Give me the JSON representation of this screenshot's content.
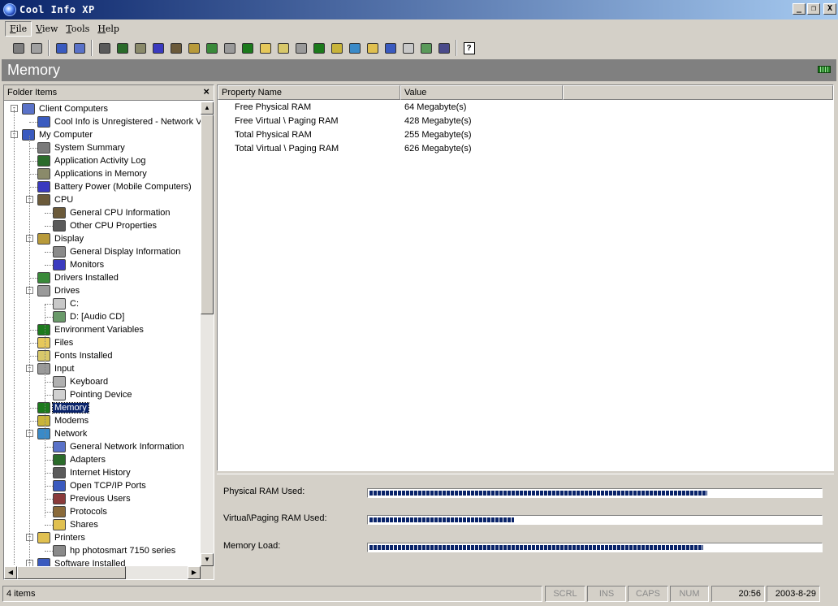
{
  "window": {
    "title": "Cool Info XP",
    "buttons": {
      "minimize": "_",
      "maximize": "❐",
      "close": "X"
    }
  },
  "menu": [
    {
      "label": "File",
      "accel": "F",
      "rest": "ile"
    },
    {
      "label": "View",
      "accel": "V",
      "rest": "iew"
    },
    {
      "label": "Tools",
      "accel": "T",
      "rest": "ools"
    },
    {
      "label": "Help",
      "accel": "H",
      "rest": "elp"
    }
  ],
  "toolbar": {
    "icons": [
      {
        "name": "cube-icon",
        "color": "#7f7f7f"
      },
      {
        "name": "network-client-icon",
        "color": "#a0a0a0"
      },
      "sep",
      {
        "name": "client-remote-icon",
        "color": "#3a5bbf"
      },
      {
        "name": "client-settings-icon",
        "color": "#5a72c8"
      },
      "sep",
      {
        "name": "computer-icon",
        "color": "#5a5a5a"
      },
      {
        "name": "activity-log-icon",
        "color": "#2a6b2a"
      },
      {
        "name": "applications-icon",
        "color": "#8a8a6a"
      },
      {
        "name": "battery-icon",
        "color": "#3a3abf"
      },
      {
        "name": "cpu-icon",
        "color": "#6b5a3a"
      },
      {
        "name": "display-icon",
        "color": "#b89a3a"
      },
      {
        "name": "drivers-icon",
        "color": "#3a8a3a"
      },
      {
        "name": "drives-icon",
        "color": "#9a9a9a"
      },
      {
        "name": "environment-icon",
        "color": "#1c7a1c"
      },
      {
        "name": "files-icon",
        "color": "#e6c85a"
      },
      {
        "name": "fonts-icon",
        "color": "#d8c86a"
      },
      {
        "name": "input-icon",
        "color": "#9a9a9a"
      },
      {
        "name": "memory-icon",
        "color": "#1c7a1c"
      },
      {
        "name": "modems-icon",
        "color": "#c8b43a"
      },
      {
        "name": "network-icon",
        "color": "#3a8ac8"
      },
      {
        "name": "printers-icon",
        "color": "#e0c050"
      },
      {
        "name": "software-icon",
        "color": "#3a5abf"
      },
      {
        "name": "sound-icon",
        "color": "#c8c8c8"
      },
      {
        "name": "system-icon",
        "color": "#5a9a5a"
      },
      {
        "name": "tools-icon",
        "color": "#4a4a8a"
      },
      "sep",
      {
        "name": "help-icon",
        "color": "#ffffff"
      }
    ]
  },
  "section": {
    "title": "Memory",
    "icon": "memory-icon"
  },
  "folder_panel": {
    "title": "Folder Items",
    "close": "×",
    "items": [
      {
        "label": "Client Computers",
        "level": 0,
        "expander": "-",
        "icon": "clients-icon",
        "color": "#5a72c8"
      },
      {
        "label": "Cool Info is Unregistered - Network Version",
        "level": 1,
        "icon": "client-icon",
        "color": "#3a5bbf"
      },
      {
        "label": "My Computer",
        "level": 0,
        "expander": "-",
        "icon": "my-computer-icon",
        "color": "#3a5abf"
      },
      {
        "label": "System Summary",
        "level": 1,
        "icon": "computer-icon",
        "color": "#7a7a7a"
      },
      {
        "label": "Application Activity Log",
        "level": 1,
        "icon": "activity-log-icon",
        "color": "#2a6b2a"
      },
      {
        "label": "Applications in Memory",
        "level": 1,
        "icon": "applications-icon",
        "color": "#8a8a6a"
      },
      {
        "label": "Battery Power (Mobile Computers)",
        "level": 1,
        "icon": "battery-icon",
        "color": "#3a3abf"
      },
      {
        "label": "CPU",
        "level": 1,
        "expander": "-",
        "icon": "cpu-icon",
        "color": "#6b5a3a"
      },
      {
        "label": "General CPU Information",
        "level": 2,
        "icon": "cpu-info-icon",
        "color": "#6b5a3a"
      },
      {
        "label": "Other CPU Properties",
        "level": 2,
        "icon": "cpu-props-icon",
        "color": "#5a5a5a"
      },
      {
        "label": "Display",
        "level": 1,
        "expander": "-",
        "icon": "display-icon",
        "color": "#b89a3a"
      },
      {
        "label": "General Display Information",
        "level": 2,
        "icon": "display-info-icon",
        "color": "#8a8a8a"
      },
      {
        "label": "Monitors",
        "level": 2,
        "icon": "monitor-icon",
        "color": "#3a3abf"
      },
      {
        "label": "Drivers Installed",
        "level": 1,
        "icon": "drivers-icon",
        "color": "#3a8a3a"
      },
      {
        "label": "Drives",
        "level": 1,
        "expander": "-",
        "icon": "drives-icon",
        "color": "#9a9a9a"
      },
      {
        "label": "C:",
        "level": 2,
        "icon": "hard-drive-icon",
        "color": "#c8c8c8"
      },
      {
        "label": "D: [Audio CD]",
        "level": 2,
        "icon": "cd-drive-icon",
        "color": "#6a9a6a"
      },
      {
        "label": "Environment Variables",
        "level": 1,
        "icon": "environment-icon",
        "color": "#1c7a1c"
      },
      {
        "label": "Files",
        "level": 1,
        "icon": "files-icon",
        "color": "#e6c85a"
      },
      {
        "label": "Fonts Installed",
        "level": 1,
        "icon": "fonts-icon",
        "color": "#d8c86a"
      },
      {
        "label": "Input",
        "level": 1,
        "expander": "-",
        "icon": "input-icon",
        "color": "#9a9a9a"
      },
      {
        "label": "Keyboard",
        "level": 2,
        "icon": "keyboard-icon",
        "color": "#b0b0b0"
      },
      {
        "label": "Pointing Device",
        "level": 2,
        "icon": "mouse-icon",
        "color": "#d0d0d0"
      },
      {
        "label": "Memory",
        "level": 1,
        "icon": "memory-icon",
        "color": "#1c7a1c",
        "selected": true
      },
      {
        "label": "Modems",
        "level": 1,
        "icon": "modems-icon",
        "color": "#c8b43a"
      },
      {
        "label": "Network",
        "level": 1,
        "expander": "-",
        "icon": "network-icon",
        "color": "#3a8ac8"
      },
      {
        "label": "General Network Information",
        "level": 2,
        "icon": "network-info-icon",
        "color": "#5a72c8"
      },
      {
        "label": "Adapters",
        "level": 2,
        "icon": "adapter-icon",
        "color": "#2a6b2a"
      },
      {
        "label": "Internet History",
        "level": 2,
        "icon": "history-icon",
        "color": "#5a5a5a"
      },
      {
        "label": "Open TCP/IP Ports",
        "level": 2,
        "icon": "ports-icon",
        "color": "#3a5abf"
      },
      {
        "label": "Previous Users",
        "level": 2,
        "icon": "users-icon",
        "color": "#8a3a3a"
      },
      {
        "label": "Protocols",
        "level": 2,
        "icon": "protocols-icon",
        "color": "#8a6a3a"
      },
      {
        "label": "Shares",
        "level": 2,
        "icon": "shares-icon",
        "color": "#e0c050"
      },
      {
        "label": "Printers",
        "level": 1,
        "expander": "-",
        "icon": "printers-icon",
        "color": "#e0c050"
      },
      {
        "label": "hp photosmart 7150 series",
        "level": 2,
        "icon": "printer-icon",
        "color": "#8a8a8a"
      },
      {
        "label": "Software Installed",
        "level": 1,
        "expander": "-",
        "icon": "software-icon",
        "color": "#3a5abf"
      }
    ]
  },
  "property_table": {
    "columns": [
      "Property Name",
      "Value"
    ],
    "rows": [
      [
        "Free Physical RAM",
        "64 Megabyte(s)"
      ],
      [
        "Free Virtual \\ Paging RAM",
        "428 Megabyte(s)"
      ],
      [
        "Total Physical RAM",
        "255 Megabyte(s)"
      ],
      [
        "Total Virtual \\ Paging RAM",
        "626 Megabyte(s)"
      ]
    ]
  },
  "usage": [
    {
      "label": "Physical RAM Used:",
      "percent": 75
    },
    {
      "label": "Virtual\\Paging RAM Used:",
      "percent": 32
    },
    {
      "label": "Memory Load:",
      "percent": 74
    }
  ],
  "status_bar": {
    "items_text": "4 items",
    "scrl": "SCRL",
    "ins": "INS",
    "caps": "CAPS",
    "num": "NUM",
    "time": "20:56",
    "date": "2003-8-29"
  },
  "colors": {
    "title_gradient_start": "#0a246a",
    "title_gradient_end": "#a6caf0",
    "selection": "#0a246a",
    "progress_fill": "#0a246a",
    "section_header": "#808080"
  }
}
